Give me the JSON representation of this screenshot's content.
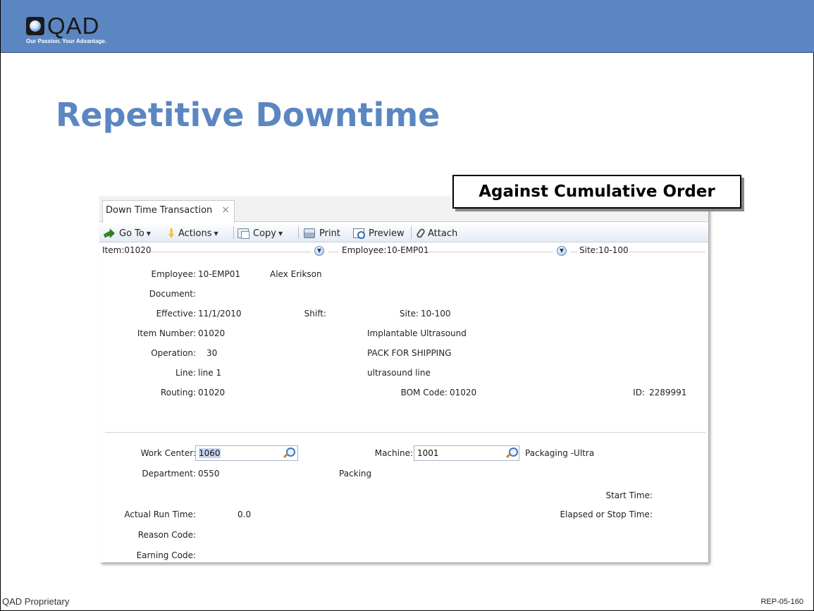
{
  "slide": {
    "logo_text": "QAD",
    "logo_tagline": "Our Passion. Your Advantage.",
    "title": "Repetitive Downtime",
    "callout": "Against Cumulative Order",
    "footer_left": "QAD Proprietary",
    "footer_right": "REP-05-160"
  },
  "window": {
    "tab_label": "Down Time Transaction",
    "tab_close": "×",
    "toolbar": {
      "goto": "Go To",
      "actions": "Actions",
      "copy": "Copy",
      "print": "Print",
      "preview": "Preview",
      "attach": "Attach"
    },
    "header": {
      "item": "Item:01020",
      "employee": "Employee:10-EMP01",
      "site": "Site:10-100"
    },
    "fields": {
      "employee_label": "Employee:",
      "employee_value": "10-EMP01",
      "employee_name": "Alex Erikson",
      "document_label": "Document:",
      "effective_label": "Effective:",
      "effective_value": "11/1/2010",
      "shift_label": "Shift:",
      "site_label": "Site:",
      "site_value": "10-100",
      "item_label": "Item Number:",
      "item_value": "01020",
      "item_desc": "Implantable Ultrasound",
      "operation_label": "Operation:",
      "operation_value": "30",
      "operation_desc": "PACK FOR SHIPPING",
      "line_label": "Line:",
      "line_value": "line 1",
      "line_desc": "ultrasound line",
      "routing_label": "Routing:",
      "routing_value": "01020",
      "bom_label": "BOM Code:",
      "bom_value": "01020",
      "id_label": "ID:",
      "id_value": "2289991",
      "work_center_label": "Work Center:",
      "work_center_value": "1060",
      "machine_label": "Machine:",
      "machine_value": "1001",
      "machine_desc": "Packaging -Ultra",
      "department_label": "Department:",
      "department_value": "0550",
      "department_desc": "Packing",
      "start_time_label": "Start Time:",
      "actual_run_label": "Actual Run Time:",
      "actual_run_value": "0.0",
      "elapsed_label": "Elapsed or Stop Time:",
      "reason_label": "Reason Code:",
      "earning_label": "Earning Code:"
    }
  }
}
